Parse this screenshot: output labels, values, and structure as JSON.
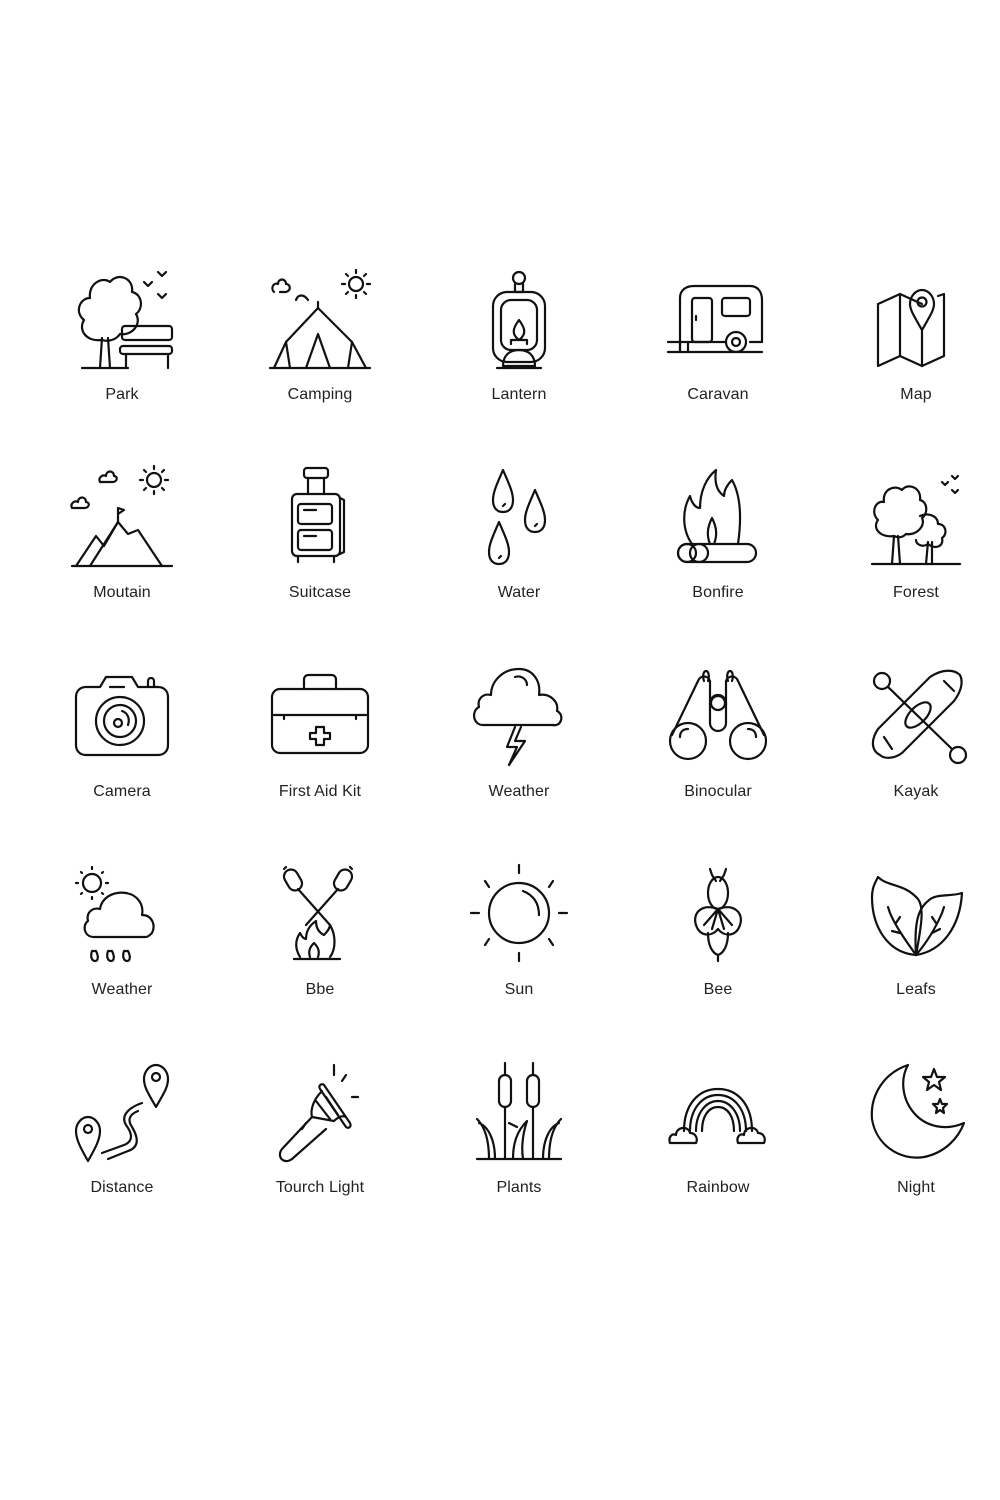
{
  "background_color": "#ffffff",
  "icon_color": "#111111",
  "label_color": "#222222",
  "icons": [
    {
      "name": "park",
      "label": "Park"
    },
    {
      "name": "camping",
      "label": "Camping"
    },
    {
      "name": "lantern",
      "label": "Lantern"
    },
    {
      "name": "caravan",
      "label": "Caravan"
    },
    {
      "name": "map",
      "label": "Map"
    },
    {
      "name": "mountain",
      "label": "Moutain"
    },
    {
      "name": "suitcase",
      "label": "Suitcase"
    },
    {
      "name": "water",
      "label": "Water"
    },
    {
      "name": "bonfire",
      "label": "Bonfire"
    },
    {
      "name": "forest",
      "label": "Forest"
    },
    {
      "name": "camera",
      "label": "Camera"
    },
    {
      "name": "first-aid-kit",
      "label": "First Aid Kit"
    },
    {
      "name": "weather-storm",
      "label": "Weather"
    },
    {
      "name": "binocular",
      "label": "Binocular"
    },
    {
      "name": "kayak",
      "label": "Kayak"
    },
    {
      "name": "weather-rain",
      "label": "Weather"
    },
    {
      "name": "bbq-marshmallow",
      "label": "Bbe"
    },
    {
      "name": "sun",
      "label": "Sun"
    },
    {
      "name": "bee",
      "label": "Bee"
    },
    {
      "name": "leafs",
      "label": "Leafs"
    },
    {
      "name": "distance",
      "label": "Distance"
    },
    {
      "name": "torch-light",
      "label": "Tourch Light"
    },
    {
      "name": "plants",
      "label": "Plants"
    },
    {
      "name": "rainbow",
      "label": "Rainbow"
    },
    {
      "name": "night",
      "label": "Night"
    }
  ]
}
